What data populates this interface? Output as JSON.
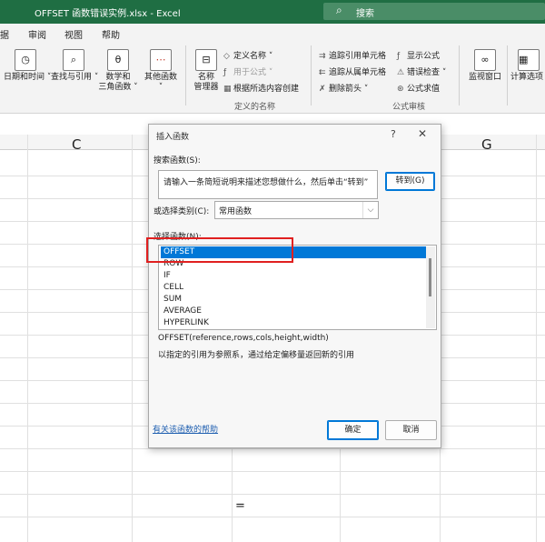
{
  "window": {
    "title": "OFFSET 函数错误实例.xlsx  -  Excel",
    "search_placeholder": "搜索"
  },
  "menu": [
    "据",
    "审阅",
    "视图",
    "帮助"
  ],
  "ribbon": {
    "big_buttons": [
      {
        "label": "日期和时间 ˅",
        "icon": "calendar-icon"
      },
      {
        "label": "查找与引用 ˅",
        "icon": "lookup-icon"
      },
      {
        "label": "数学和\n三角函数 ˅",
        "icon": "theta-icon"
      },
      {
        "label": "其他函数\n˅",
        "icon": "more-functions-icon"
      },
      {
        "label": "名称\n管理器",
        "icon": "name-manager-icon"
      }
    ],
    "define_names": {
      "items": [
        "定义名称 ˅",
        "用于公式 ˅",
        "根据所选内容创建"
      ],
      "group_label": "定义的名称"
    },
    "formula_audit": {
      "items": [
        "追踪引用单元格",
        "显示公式",
        "追踪从属单元格",
        "错误检查 ˅",
        "删除箭头 ˅",
        "公式求值"
      ],
      "group_label": "公式审核"
    },
    "watch_window": "监视窗口",
    "calc_options": "计算选项"
  },
  "sheet": {
    "columns": [
      "C",
      "G"
    ],
    "cell_text": "="
  },
  "dialog": {
    "title": "插入函数",
    "help_glyph": "?",
    "close_glyph": "✕",
    "search_label": "搜索函数(S):",
    "search_text": "请输入一条简短说明来描述您想做什么，然后单击“转到”",
    "go_button": "转到(G)",
    "category_label": "或选择类别(C):",
    "category_value": "常用函数",
    "function_list_label": "选择函数(N):",
    "functions": [
      "OFFSET",
      "ROW",
      "IF",
      "CELL",
      "SUM",
      "AVERAGE",
      "HYPERLINK"
    ],
    "selected_function": "OFFSET",
    "syntax": "OFFSET(reference,rows,cols,height,width)",
    "description": "以指定的引用为参照系，通过给定偏移量返回新的引用",
    "help_link": "有关该函数的帮助",
    "ok_button": "确定",
    "cancel_button": "取消"
  }
}
